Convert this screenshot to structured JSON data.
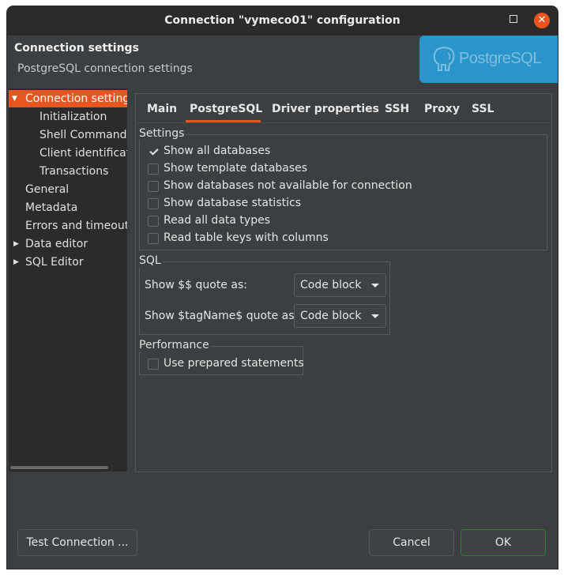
{
  "window": {
    "title": "Connection \"vymeco01\" configuration"
  },
  "header": {
    "title": "Connection settings",
    "subtitle": "PostgreSQL connection settings",
    "logo_text": "PostgreSQL",
    "banner_color": "#2a95cb"
  },
  "sidebar": {
    "items": [
      {
        "label": "Connection settings",
        "expanded": true,
        "selected": true
      },
      {
        "label": "Initialization"
      },
      {
        "label": "Shell Commands"
      },
      {
        "label": "Client identificat"
      },
      {
        "label": "Transactions"
      },
      {
        "label": "General"
      },
      {
        "label": "Metadata"
      },
      {
        "label": "Errors and timeouts"
      },
      {
        "label": "Data editor",
        "collapsed": true
      },
      {
        "label": "SQL Editor",
        "collapsed": true
      }
    ]
  },
  "tabs": [
    "Main",
    "PostgreSQL",
    "Driver properties",
    "SSH",
    "Proxy",
    "SSL"
  ],
  "active_tab": "PostgreSQL",
  "settings": {
    "label": "Settings",
    "options": [
      {
        "label": "Show all databases",
        "checked": true
      },
      {
        "label": "Show template databases",
        "checked": false
      },
      {
        "label": "Show databases not available for connection",
        "checked": false
      },
      {
        "label": "Show database statistics",
        "checked": false
      },
      {
        "label": "Read all data types",
        "checked": false
      },
      {
        "label": "Read table keys with columns",
        "checked": false
      }
    ]
  },
  "sql": {
    "label": "SQL",
    "dollar_quote_label": "Show $$ quote as:",
    "dollar_quote_value": "Code block",
    "tagname_quote_label": "Show $tagName$ quote as:",
    "tagname_quote_value": "Code block"
  },
  "performance": {
    "label": "Performance",
    "prepared_label": "Use prepared statements",
    "prepared_checked": false
  },
  "footer": {
    "test_label": "Test Connection ...",
    "cancel_label": "Cancel",
    "ok_label": "OK"
  },
  "colors": {
    "accent": "#e9541f",
    "background": "#3c3f41",
    "sidebar": "#2b2b2b"
  }
}
